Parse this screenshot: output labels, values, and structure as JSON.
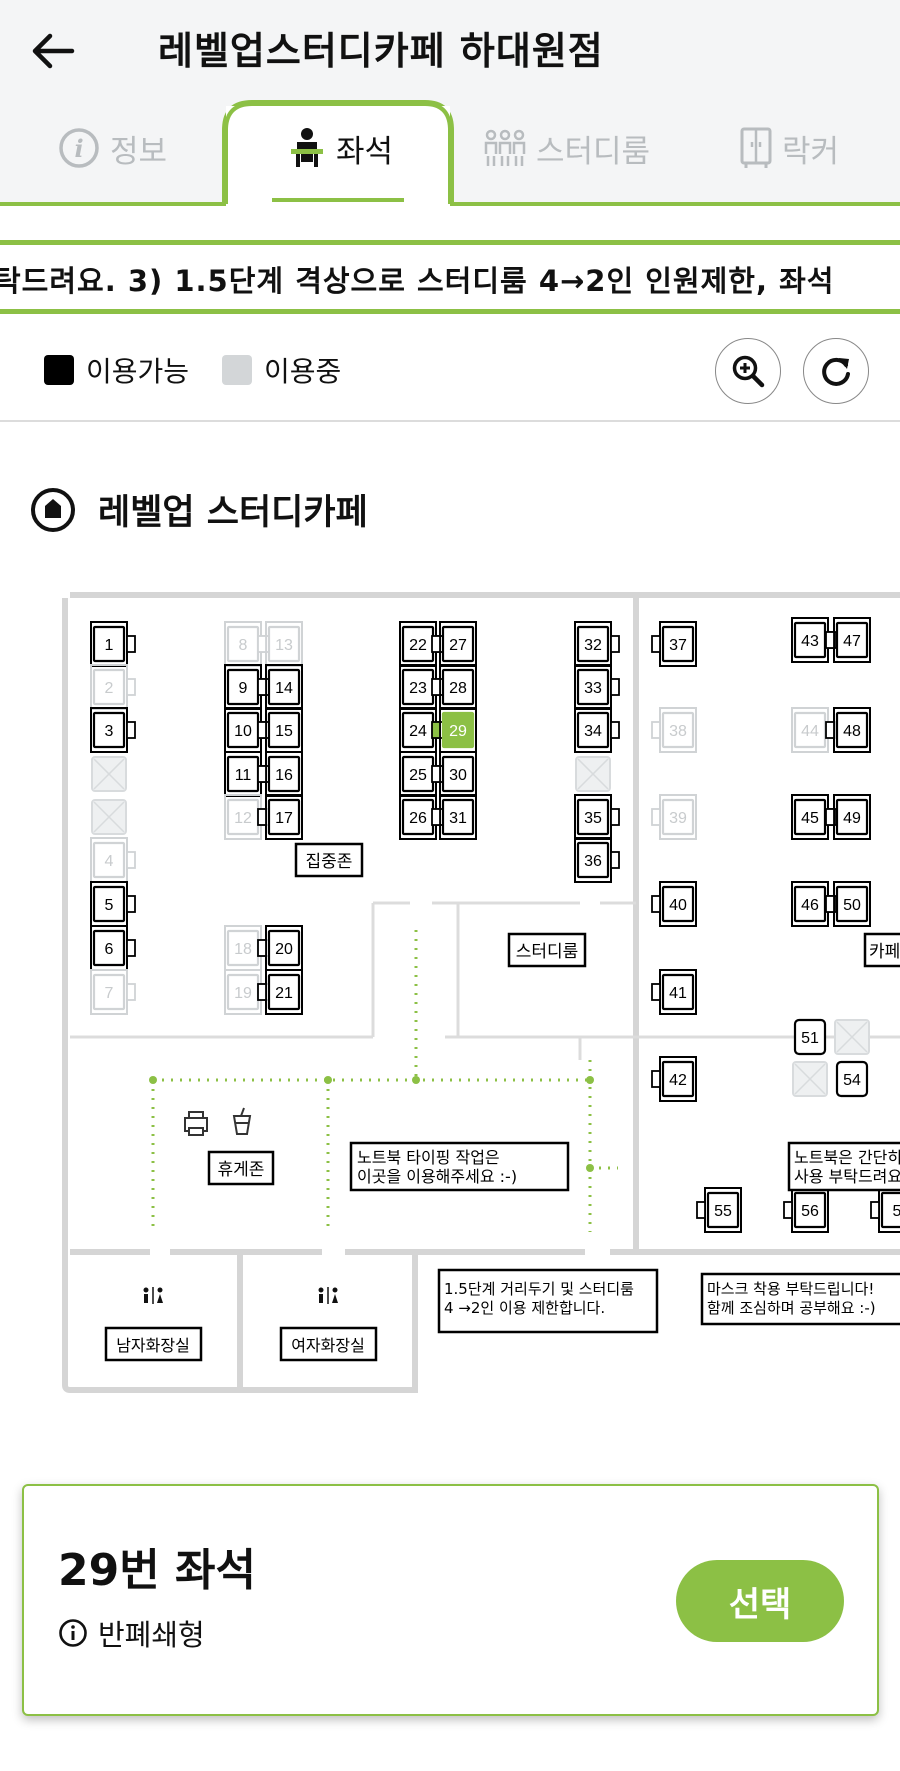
{
  "header": {
    "title": "레벨업스터디카페 하대원점",
    "tabs": [
      {
        "label": "정보",
        "icon": "info-icon",
        "active": false
      },
      {
        "label": "좌석",
        "icon": "seat-person-icon",
        "active": true
      },
      {
        "label": "스터디룸",
        "icon": "group-people-icon",
        "active": false
      },
      {
        "label": "락커",
        "icon": "locker-icon",
        "active": false
      }
    ]
  },
  "notice": {
    "text": "탁드려요. 3) 1.5단계 격상으로 스터디룸 4→2인 인원제한, 좌석"
  },
  "legend": {
    "available": {
      "label": "이용가능",
      "color": "#000000"
    },
    "in_use": {
      "label": "이용중",
      "color": "#d3d6d8"
    }
  },
  "controls": {
    "zoom_icon": "zoom-in-icon",
    "refresh_icon": "refresh-icon"
  },
  "cafe": {
    "name": "레벨업 스터디카페",
    "icon": "location-pin-icon"
  },
  "map": {
    "accent": "#8cc045",
    "seats": [
      {
        "no": "1",
        "state": "available"
      },
      {
        "no": "2",
        "state": "in-use"
      },
      {
        "no": "3",
        "state": "available"
      },
      {
        "no": "4",
        "state": "in-use"
      },
      {
        "no": "5",
        "state": "available"
      },
      {
        "no": "6",
        "state": "available"
      },
      {
        "no": "7",
        "state": "in-use"
      },
      {
        "no": "8",
        "state": "in-use"
      },
      {
        "no": "9",
        "state": "available"
      },
      {
        "no": "10",
        "state": "available"
      },
      {
        "no": "11",
        "state": "available"
      },
      {
        "no": "12",
        "state": "in-use"
      },
      {
        "no": "13",
        "state": "in-use"
      },
      {
        "no": "14",
        "state": "available"
      },
      {
        "no": "15",
        "state": "available"
      },
      {
        "no": "16",
        "state": "available"
      },
      {
        "no": "17",
        "state": "available"
      },
      {
        "no": "18",
        "state": "in-use"
      },
      {
        "no": "19",
        "state": "in-use"
      },
      {
        "no": "20",
        "state": "available"
      },
      {
        "no": "21",
        "state": "available"
      },
      {
        "no": "22",
        "state": "available"
      },
      {
        "no": "23",
        "state": "available"
      },
      {
        "no": "24",
        "state": "available"
      },
      {
        "no": "25",
        "state": "available"
      },
      {
        "no": "26",
        "state": "available"
      },
      {
        "no": "27",
        "state": "available"
      },
      {
        "no": "28",
        "state": "available"
      },
      {
        "no": "29",
        "state": "selected"
      },
      {
        "no": "30",
        "state": "available"
      },
      {
        "no": "31",
        "state": "available"
      },
      {
        "no": "32",
        "state": "available"
      },
      {
        "no": "33",
        "state": "available"
      },
      {
        "no": "34",
        "state": "available"
      },
      {
        "no": "35",
        "state": "available"
      },
      {
        "no": "36",
        "state": "available"
      },
      {
        "no": "37",
        "state": "available"
      },
      {
        "no": "38",
        "state": "in-use"
      },
      {
        "no": "39",
        "state": "in-use"
      },
      {
        "no": "40",
        "state": "available"
      },
      {
        "no": "41",
        "state": "available"
      },
      {
        "no": "42",
        "state": "available"
      },
      {
        "no": "43",
        "state": "available"
      },
      {
        "no": "44",
        "state": "in-use"
      },
      {
        "no": "45",
        "state": "available"
      },
      {
        "no": "46",
        "state": "available"
      },
      {
        "no": "47",
        "state": "available"
      },
      {
        "no": "48",
        "state": "available"
      },
      {
        "no": "49",
        "state": "available"
      },
      {
        "no": "50",
        "state": "available"
      },
      {
        "no": "51",
        "state": "available"
      },
      {
        "no": "54",
        "state": "available"
      },
      {
        "no": "55",
        "state": "available"
      },
      {
        "no": "56",
        "state": "available"
      },
      {
        "no": "5",
        "state": "available"
      }
    ],
    "zones": {
      "focus": "집중존",
      "study_room": "스터디룸",
      "lounge": "휴게존",
      "cafe_zone": "카페",
      "mens_room": "남자화장실",
      "womens_room": "여자화장실"
    },
    "notes": {
      "laptop_line1": "노트북 타이핑 작업은",
      "laptop_line2": "이곳을 이용해주세요 :-)",
      "simple_line1": "노트북은 간단히",
      "simple_line2": "사용 부탁드려요",
      "distance_line1": "1.5단계 거리두기 및 스터디룸",
      "distance_line2": "4 →2인 이용 제한합니다.",
      "mask_line1": "마스크 착용 부탁드립니다!",
      "mask_line2": "함께 조심하며 공부해요 :-)"
    },
    "restroom_icon": "restroom-icon",
    "printer_icon": "printer-icon",
    "drink_icon": "drink-icon"
  },
  "selection": {
    "seat_name": "29번 좌석",
    "seat_type": "반폐쇄형",
    "select_label": "선택"
  }
}
